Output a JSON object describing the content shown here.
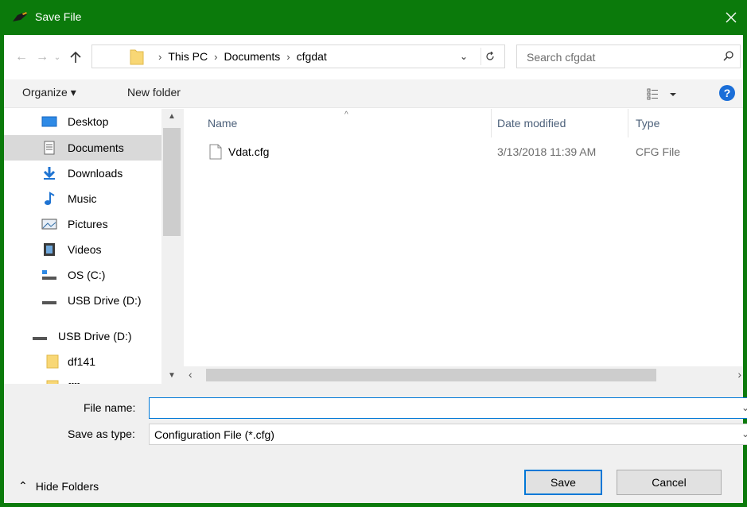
{
  "window": {
    "title": "Save File",
    "accent_color": "#0b7a0b",
    "close_icon": "close-icon"
  },
  "address_bar": {
    "breadcrumbs": [
      "This PC",
      "Documents",
      "cfgdat"
    ]
  },
  "search": {
    "placeholder": "Search cfgdat"
  },
  "toolbar": {
    "organize_label": "Organize ▾",
    "new_folder_label": "New folder",
    "help_label": "?"
  },
  "sidebar": {
    "items": [
      {
        "label": "Desktop",
        "icon": "desktop-icon"
      },
      {
        "label": "Documents",
        "icon": "documents-icon",
        "selected": true
      },
      {
        "label": "Downloads",
        "icon": "downloads-icon"
      },
      {
        "label": "Music",
        "icon": "music-icon"
      },
      {
        "label": "Pictures",
        "icon": "pictures-icon"
      },
      {
        "label": "Videos",
        "icon": "videos-icon"
      },
      {
        "label": "OS (C:)",
        "icon": "drive-icon"
      },
      {
        "label": "USB Drive (D:)",
        "icon": "usb-drive-icon"
      },
      {
        "label": "USB Drive (D:)",
        "icon": "usb-drive-icon"
      },
      {
        "label": "df141",
        "icon": "folder-icon"
      },
      {
        "label": "ffff",
        "icon": "folder-icon"
      }
    ]
  },
  "file_list": {
    "columns": [
      "Name",
      "Date modified",
      "Type"
    ],
    "rows": [
      {
        "name": "Vdat.cfg",
        "date": "3/13/2018 11:39 AM",
        "type": "CFG File"
      }
    ]
  },
  "form": {
    "file_name_label": "File name:",
    "file_name_value": "",
    "save_as_type_label": "Save as type:",
    "save_as_type_value": "Configuration File (*.cfg)"
  },
  "buttons": {
    "hide_folders": "Hide Folders",
    "save": "Save",
    "cancel": "Cancel"
  }
}
